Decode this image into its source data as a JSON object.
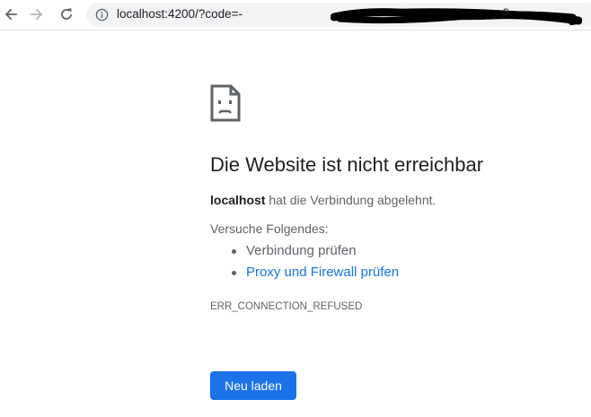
{
  "browser": {
    "address_bar": {
      "url_visible": "localhost:4200/?code=-",
      "url_tail": "s"
    },
    "icons": {
      "back": "arrow-left-icon",
      "forward": "arrow-right-icon",
      "reload": "reload-icon",
      "info": "info-icon"
    }
  },
  "error_page": {
    "icon": "sad-page-icon",
    "headline": "Die Website ist nicht erreichbar",
    "summary_host": "localhost",
    "summary_text": " hat die Verbindung abgelehnt.",
    "suggestions_title": "Versuche Folgendes:",
    "suggestions": [
      {
        "label": "Verbindung prüfen"
      },
      {
        "label": "Proxy und Firewall prüfen"
      }
    ],
    "error_code": "ERR_CONNECTION_REFUSED",
    "reload_button": "Neu laden"
  },
  "colors": {
    "accent": "#1a73e8",
    "text_primary": "#202124",
    "text_secondary": "#5f6368",
    "omnibox_bg": "#f1f3f4"
  }
}
